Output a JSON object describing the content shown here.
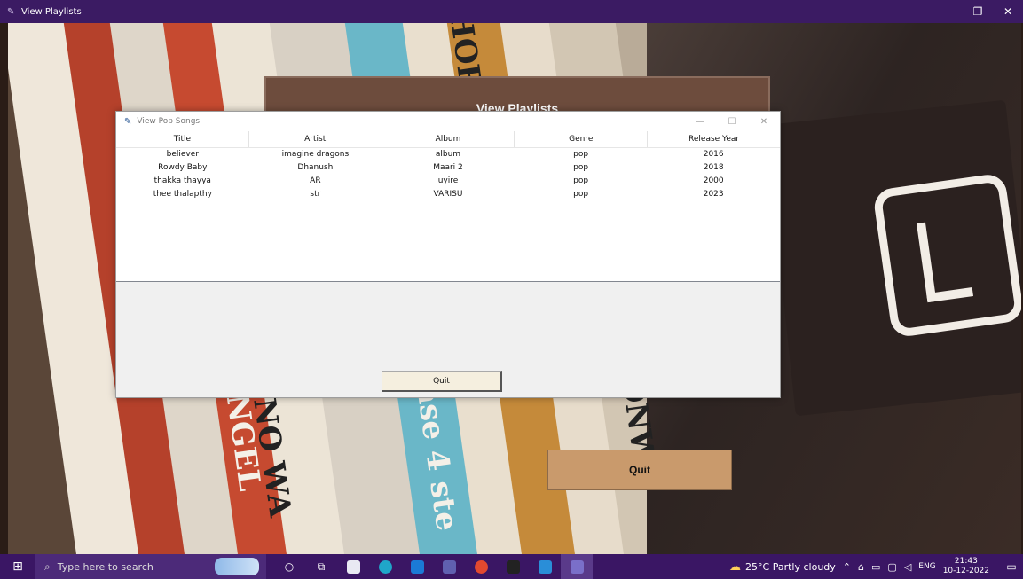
{
  "main_window": {
    "title": "View Playlists",
    "header_text": "View Playlists",
    "quit_label": "Quit"
  },
  "dialog": {
    "title": "View Pop Songs",
    "columns": [
      "Title",
      "Artist",
      "Album",
      "Genre",
      "Release Year"
    ],
    "rows": [
      [
        "believer",
        "imagine dragons",
        "album",
        "pop",
        "2016"
      ],
      [
        "Rowdy Baby",
        "Dhanush",
        "Maari 2",
        "pop",
        "2018"
      ],
      [
        "thakka thayya",
        "AR",
        "uyire",
        "pop",
        "2000"
      ],
      [
        "thee thalapthy",
        "str",
        "VARISU",
        "pop",
        "2023"
      ]
    ],
    "quit_label": "Quit"
  },
  "background_text": {
    "book_1": "ANGEL",
    "book_2": "NO WA",
    "book_3": "ase 4 ste",
    "book_4": "HOR",
    "book_5": "ONWA"
  },
  "taskbar": {
    "search_placeholder": "Type here to search",
    "weather": "25°C  Partly cloudy",
    "language": "ENG",
    "time": "21:43",
    "date": "10-12-2022"
  },
  "colors": {
    "titlebar": "#3b1b63",
    "taskbar": "#3a1664",
    "header_brown": "#6d4c3d",
    "quit_tan": "#c99a6c"
  }
}
